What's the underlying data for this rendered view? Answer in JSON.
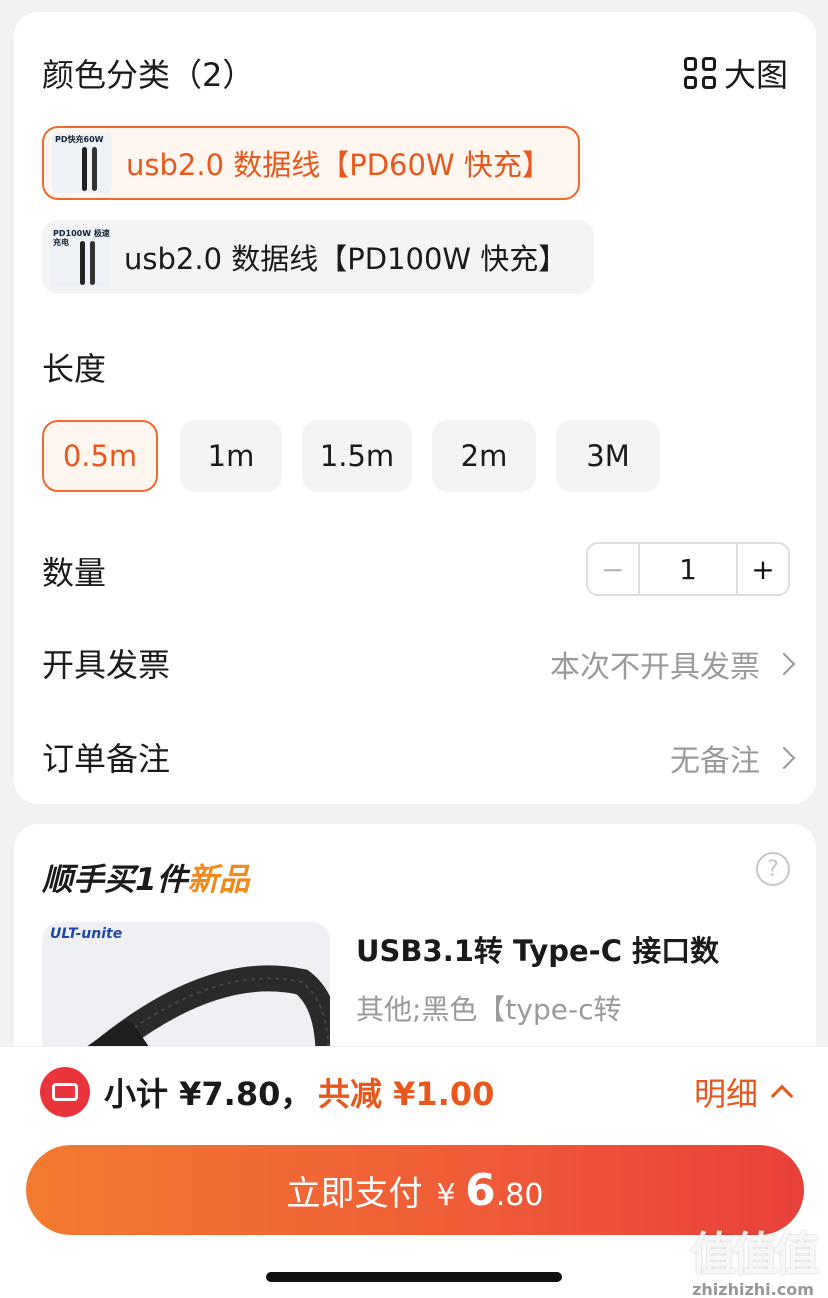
{
  "spec": {
    "color_title": "颜色分类（2）",
    "big_view_label": "大图",
    "variants": [
      {
        "label": "usb2.0 数据线【PD60W 快充】",
        "thumb_text": "PD快充60W",
        "selected": true
      },
      {
        "label": "usb2.0 数据线【PD100W 快充】",
        "thumb_text": "PD100W 极速充电",
        "selected": false
      }
    ],
    "length_title": "长度",
    "lengths": [
      {
        "label": "0.5m",
        "selected": true
      },
      {
        "label": "1m",
        "selected": false
      },
      {
        "label": "1.5m",
        "selected": false
      },
      {
        "label": "2m",
        "selected": false
      },
      {
        "label": "3M",
        "selected": false
      }
    ],
    "quantity_title": "数量",
    "quantity": {
      "minus": "−",
      "value": "1",
      "plus": "+"
    },
    "invoice_title": "开具发票",
    "invoice_value": "本次不开具发票",
    "note_title": "订单备注",
    "note_value": "无备注"
  },
  "addon": {
    "title_prefix": "顺手买1件",
    "title_tag": "新品",
    "help_icon": "?",
    "product_brand": "ULT-unite",
    "product_title": "USB3.1转 Type-C 接口数",
    "product_sub": "其他;黑色【type-c转"
  },
  "footer": {
    "subtotal": "小计 ¥7.80，",
    "discount": "共减 ¥1.00",
    "detail": "明细",
    "pay_label": "立即支付",
    "pay_currency": "¥",
    "pay_int": "6",
    "pay_dec": ".80"
  },
  "watermark": {
    "logo": "值值值",
    "site": "zhizhizhi.com"
  },
  "colors": {
    "accent": "#e8581c",
    "pay_gradient_start": "#f27a30",
    "pay_gradient_end": "#e8403a",
    "coupon_red": "#e8343a"
  }
}
